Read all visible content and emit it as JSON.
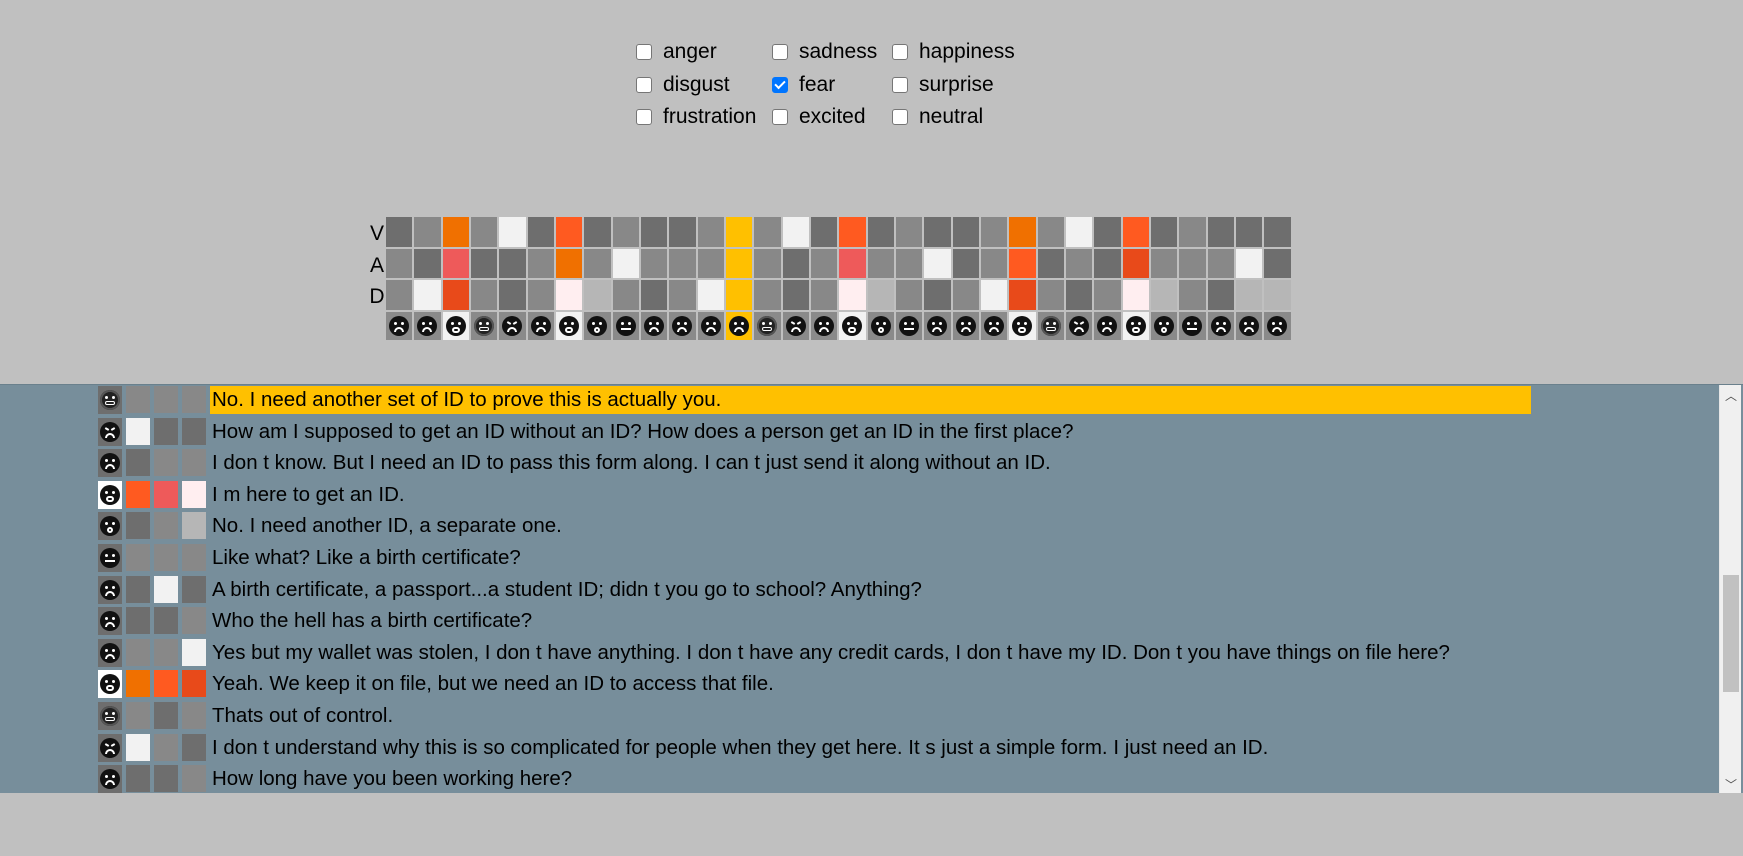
{
  "filters": [
    {
      "label": "anger",
      "checked": false
    },
    {
      "label": "sadness",
      "checked": false
    },
    {
      "label": "happiness",
      "checked": false
    },
    {
      "label": "disgust",
      "checked": false
    },
    {
      "label": "fear",
      "checked": true
    },
    {
      "label": "surprise",
      "checked": false
    },
    {
      "label": "frustration",
      "checked": false
    },
    {
      "label": "excited",
      "checked": false
    },
    {
      "label": "neutral",
      "checked": false
    }
  ],
  "vad_labels": [
    "V",
    "A",
    "D"
  ],
  "colors": {
    "g1": "#6e6e6e",
    "g2": "#7a7a7a",
    "g3": "#888888",
    "g4": "#9a9a9a",
    "g5": "#b6b6b6",
    "white": "#f2f2f2",
    "pink": "#ffeef0",
    "orange": "#f07000",
    "orangered": "#ff5a20",
    "red": "#ee5a5a",
    "deep": "#e84a1a",
    "amber": "#ffc000"
  },
  "strip": [
    {
      "v": "g1",
      "a": "g3",
      "d": "g3",
      "face": "sadness"
    },
    {
      "v": "g3",
      "a": "g1",
      "d": "white",
      "face": "sadness"
    },
    {
      "v": "orange",
      "a": "red",
      "d": "deep",
      "face": "fear",
      "highlight": "white"
    },
    {
      "v": "g3",
      "a": "g1",
      "d": "g3",
      "face": "neutral"
    },
    {
      "v": "white",
      "a": "g1",
      "d": "g1",
      "face": "anger"
    },
    {
      "v": "g1",
      "a": "g3",
      "d": "g3",
      "face": "sadness"
    },
    {
      "v": "orangered",
      "a": "orange",
      "d": "pink",
      "face": "fear",
      "highlight": "white"
    },
    {
      "v": "g1",
      "a": "g3",
      "d": "g5",
      "face": "surprise"
    },
    {
      "v": "g3",
      "a": "white",
      "d": "g3",
      "face": "frustration"
    },
    {
      "v": "g1",
      "a": "g3",
      "d": "g1",
      "face": "sadness"
    },
    {
      "v": "g1",
      "a": "g3",
      "d": "g3",
      "face": "sadness"
    },
    {
      "v": "g3",
      "a": "g3",
      "d": "white",
      "face": "sadness"
    },
    {
      "v": "amber",
      "a": "amber",
      "d": "amber",
      "face": "sadness",
      "highlight": "amber"
    },
    {
      "v": "g3",
      "a": "g3",
      "d": "g3",
      "face": "neutral"
    },
    {
      "v": "white",
      "a": "g1",
      "d": "g1",
      "face": "anger"
    },
    {
      "v": "g1",
      "a": "g3",
      "d": "g3",
      "face": "sadness"
    },
    {
      "v": "orangered",
      "a": "red",
      "d": "pink",
      "face": "fear",
      "highlight": "white"
    },
    {
      "v": "g1",
      "a": "g3",
      "d": "g5",
      "face": "surprise"
    },
    {
      "v": "g3",
      "a": "g3",
      "d": "g3",
      "face": "frustration"
    },
    {
      "v": "g1",
      "a": "white",
      "d": "g1",
      "face": "sadness"
    },
    {
      "v": "g1",
      "a": "g1",
      "d": "g3",
      "face": "sadness"
    },
    {
      "v": "g3",
      "a": "g3",
      "d": "white",
      "face": "sadness"
    },
    {
      "v": "orange",
      "a": "orangered",
      "d": "deep",
      "face": "fear",
      "highlight": "white"
    },
    {
      "v": "g3",
      "a": "g1",
      "d": "g3",
      "face": "neutral"
    },
    {
      "v": "white",
      "a": "g3",
      "d": "g1",
      "face": "anger"
    },
    {
      "v": "g1",
      "a": "g1",
      "d": "g3",
      "face": "sadness"
    },
    {
      "v": "orangered",
      "a": "deep",
      "d": "pink",
      "face": "fear",
      "highlight": "white"
    },
    {
      "v": "g1",
      "a": "g3",
      "d": "g5",
      "face": "surprise"
    },
    {
      "v": "g3",
      "a": "g3",
      "d": "g3",
      "face": "frustration"
    },
    {
      "v": "g1",
      "a": "g3",
      "d": "g1",
      "face": "sadness"
    },
    {
      "v": "g1",
      "a": "white",
      "d": "g5",
      "face": "sadness"
    },
    {
      "v": "g1",
      "a": "g1",
      "d": "g5",
      "face": "sadness"
    }
  ],
  "utterances": [
    {
      "face": "neutral",
      "v": "g3",
      "a": "g3",
      "d": "g3",
      "text": "No. I need another set of ID to prove this is actually you.",
      "selected": true
    },
    {
      "face": "anger",
      "v": "white",
      "a": "g1",
      "d": "g1",
      "text": "How am I supposed to get an ID without an ID? How does a person get an ID in the first place?"
    },
    {
      "face": "sadness",
      "v": "g1",
      "a": "g3",
      "d": "g3",
      "text": "I don t know. But I need an ID to pass this form along. I can t just send it along without an ID."
    },
    {
      "face": "fear",
      "v": "orangered",
      "a": "red",
      "d": "pink",
      "text": "I m here to get an ID.",
      "highlight": true
    },
    {
      "face": "surprise",
      "v": "g1",
      "a": "g3",
      "d": "g5",
      "text": "No. I need another ID, a separate one."
    },
    {
      "face": "frustration",
      "v": "g3",
      "a": "g3",
      "d": "g3",
      "text": "Like what? Like a birth certificate?"
    },
    {
      "face": "sadness",
      "v": "g1",
      "a": "white",
      "d": "g1",
      "text": "A birth certificate, a passport...a student ID; didn t you go to school? Anything?"
    },
    {
      "face": "sadness",
      "v": "g1",
      "a": "g1",
      "d": "g3",
      "text": "Who the hell has a birth certificate?"
    },
    {
      "face": "sadness",
      "v": "g3",
      "a": "g3",
      "d": "white",
      "text": "Yes but my wallet was stolen, I don t have anything. I don t have any credit cards, I don t have my ID. Don t you have things on file here?"
    },
    {
      "face": "fear",
      "v": "orange",
      "a": "orangered",
      "d": "deep",
      "text": "Yeah. We keep it on file, but we need an ID to access that file.",
      "highlight": true
    },
    {
      "face": "neutral",
      "v": "g3",
      "a": "g1",
      "d": "g3",
      "text": "Thats out of control."
    },
    {
      "face": "anger",
      "v": "white",
      "a": "g3",
      "d": "g1",
      "text": "I don t understand why this is so complicated for people when they get here. It s just a simple form. I just need an ID."
    },
    {
      "face": "sadness",
      "v": "g1",
      "a": "g1",
      "d": "g3",
      "text": "How long have you been working here?"
    }
  ],
  "scroll": {
    "up_glyph": "︿",
    "down_glyph": "﹀"
  }
}
